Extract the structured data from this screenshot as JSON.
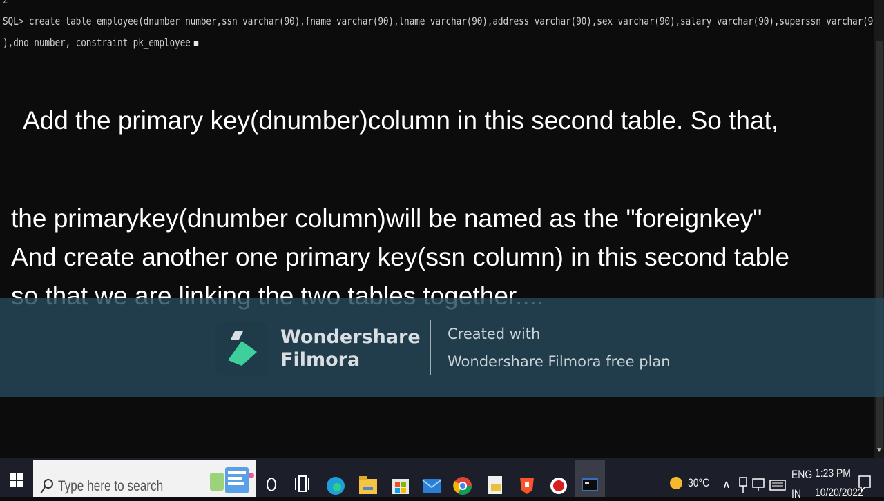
{
  "console": {
    "line0": "2",
    "line1": "SQL> create table employee(dnumber number,ssn varchar(90),fname varchar(90),lname varchar(90),address varchar(90),sex varchar(90),salary varchar(90),superssn varchar(90",
    "line2": "),dno number, constraint pk_employee"
  },
  "captions": [
    "Add the primary key(dnumber)column in this second table. So that,",
    "the primarykey(dnumber column)will be named as the \"foreignkey\"",
    "And create another one primary key(ssn column) in this second table",
    "so that we are linking the two tables together...."
  ],
  "watermark": {
    "brand_line1": "Wondershare",
    "brand_line2": "Filmora",
    "created_with": "Created with",
    "plan": "Wondershare Filmora free plan"
  },
  "taskbar": {
    "search_placeholder": "Type here to search",
    "icons": [
      "start-icon",
      "search-icon",
      "cortana-icon",
      "task-view-icon",
      "edge-icon",
      "file-explorer-icon",
      "store-icon",
      "mail-icon",
      "chrome-icon",
      "acrobat-icon",
      "brave-icon",
      "recorder-icon",
      "sql-console-icon"
    ],
    "weather": "30°C",
    "language_line1": "ENG",
    "language_line2": "IN",
    "time": "1:23 PM",
    "date": "10/20/2022"
  },
  "colors": {
    "console_bg": "#0c0c0c",
    "watermark_band": "#26485a",
    "taskbar_bg": "#1c1f2a",
    "filmora_green": "#3ecf9a"
  }
}
